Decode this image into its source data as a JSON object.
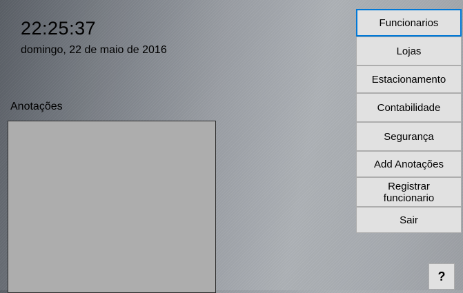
{
  "clock": {
    "time": "22:25:37",
    "date": "domingo, 22 de maio de 2016"
  },
  "notes": {
    "label": "Anotações"
  },
  "menu": {
    "items": [
      {
        "label": "Funcionarios"
      },
      {
        "label": "Lojas"
      },
      {
        "label": "Estacionamento"
      },
      {
        "label": "Contabilidade"
      },
      {
        "label": "Segurança"
      },
      {
        "label": "Add Anotações"
      },
      {
        "label": "Registrar funcionario"
      },
      {
        "label": "Sair"
      }
    ]
  },
  "help": {
    "label": "?"
  },
  "colors": {
    "accent": "#0078d7",
    "button_bg": "#e1e1e1",
    "notes_bg": "#adadad"
  }
}
